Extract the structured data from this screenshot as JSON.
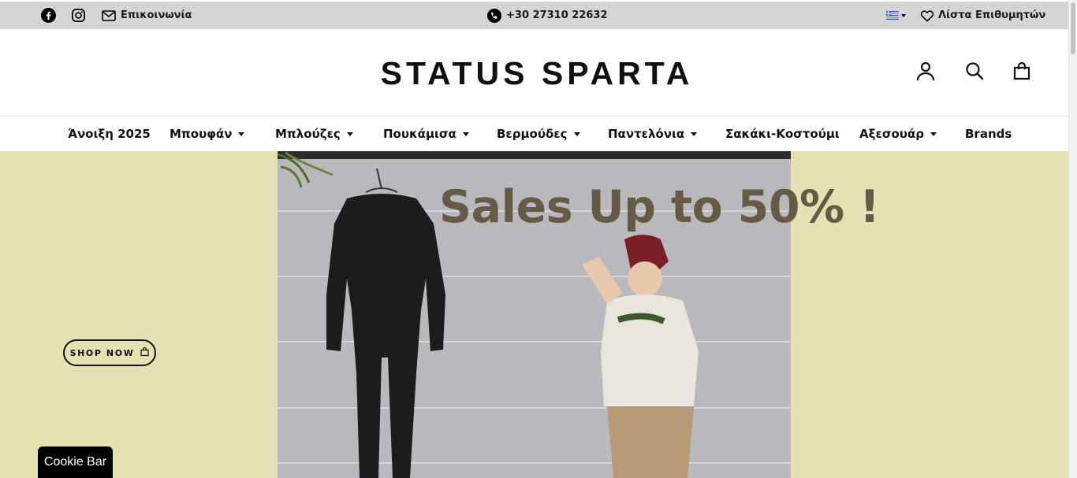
{
  "topbar": {
    "contact_label": "Επικοινωνία",
    "phone": "+30 27310 22632",
    "wishlist_label": "Λίστα Επιθυμητών"
  },
  "header": {
    "logo": "STATUS SPARTA"
  },
  "nav": {
    "items": [
      {
        "label": "Άνοιξη 2025",
        "dropdown": false
      },
      {
        "label": "Μπουφάν",
        "dropdown": true
      },
      {
        "label": "Μπλούζες",
        "dropdown": true
      },
      {
        "label": "Πουκάμισα",
        "dropdown": true
      },
      {
        "label": "Βερμούδες",
        "dropdown": true
      },
      {
        "label": "Παντελόνια",
        "dropdown": true
      },
      {
        "label": "Σακάκι-Κοστούμι",
        "dropdown": false
      },
      {
        "label": "Αξεσουάρ",
        "dropdown": true
      },
      {
        "label": "Brands",
        "dropdown": false
      }
    ]
  },
  "hero": {
    "headline": "Sales Up to 50% !",
    "shop_button": "SHOP NOW",
    "background_color": "#e4e1b3",
    "headline_color": "#645a46"
  },
  "cookie_bar": {
    "label": "Cookie Bar"
  },
  "icons": {
    "facebook": "facebook-icon",
    "instagram": "instagram-icon",
    "mail": "mail-icon",
    "phone": "phone-icon",
    "flag": "greek-flag-icon",
    "heart": "heart-icon",
    "account": "user-icon",
    "search": "search-icon",
    "cart": "shopping-bag-icon"
  }
}
